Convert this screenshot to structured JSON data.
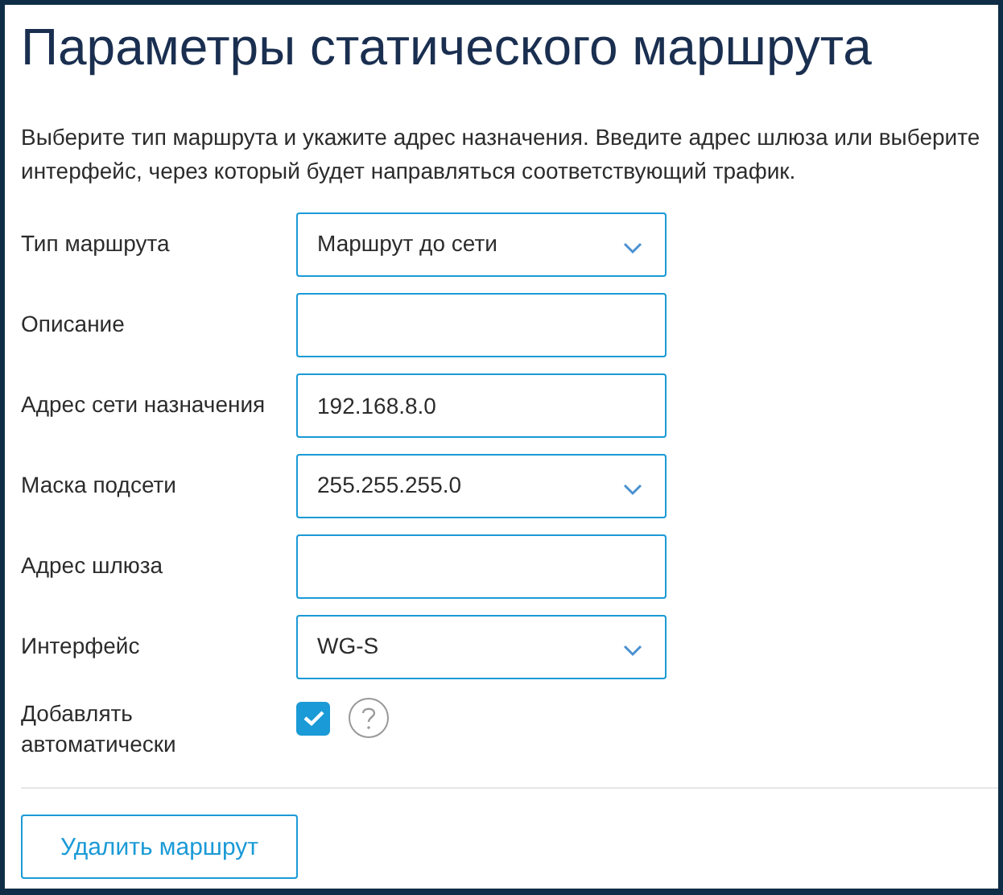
{
  "title": "Параметры статического маршрута",
  "description": "Выберите тип маршрута и укажите адрес назначения. Введите адрес шлюза или выберите интерфейс, через который будет направляться соответствующий трафик.",
  "fields": [
    {
      "label": "Тип маршрута",
      "kind": "select",
      "value": "Маршрут до сети"
    },
    {
      "label": "Описание",
      "kind": "input"
    },
    {
      "label": "Адрес сети назначения",
      "kind": "input",
      "value": "192.168.8.0"
    },
    {
      "label": "Маска подсети",
      "kind": "select",
      "value": "255.255.255.0"
    },
    {
      "label": "Адрес шлюза",
      "kind": "input"
    },
    {
      "label": "Интерфейс",
      "kind": "select",
      "value": "WG-S"
    },
    {
      "label": "Добавлять автоматически",
      "kind": "checkbox",
      "checked": true
    }
  ],
  "buttons": [
    "Удалить маршрут"
  ]
}
